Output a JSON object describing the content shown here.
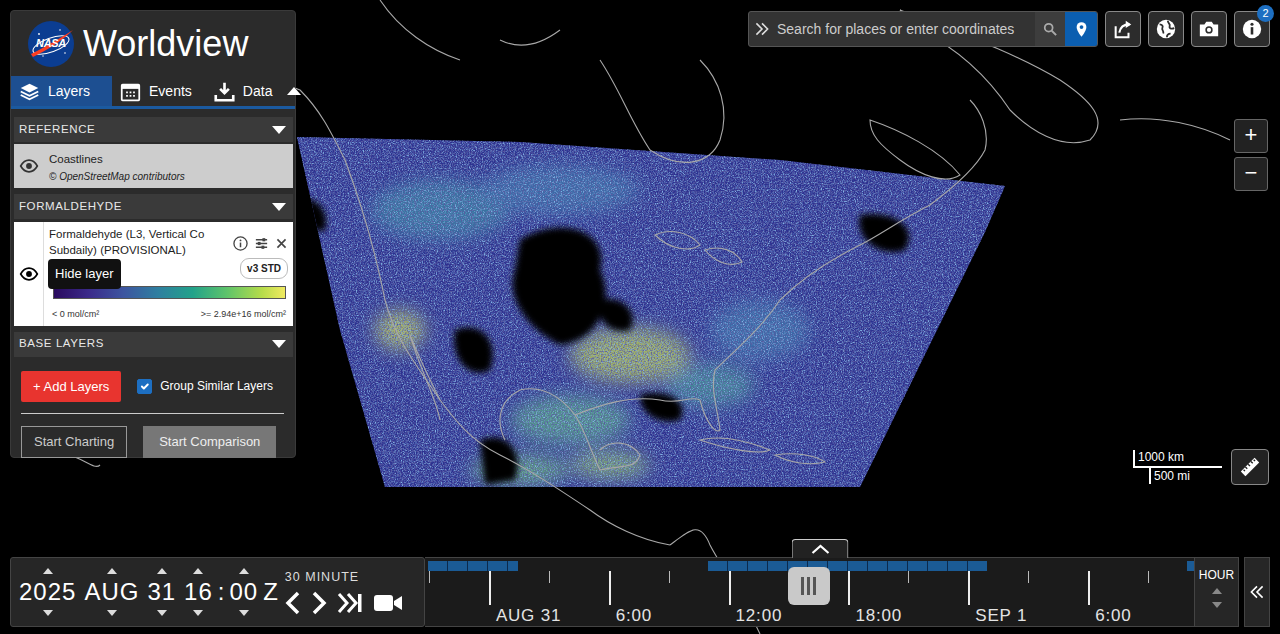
{
  "app": {
    "logo_text": "NASA",
    "title": "Worldview"
  },
  "tabs": [
    {
      "label": "Layers",
      "selected": true
    },
    {
      "label": "Events",
      "selected": false
    },
    {
      "label": "Data",
      "selected": false
    }
  ],
  "layer_groups": [
    {
      "title": "REFERENCE",
      "expanded": true,
      "layers": [
        {
          "kind": "reference",
          "title_lines": [
            "Coastlines"
          ],
          "subtitle": "© OpenStreetMap contributors",
          "visible": true
        }
      ]
    },
    {
      "title": "FORMALDEHYDE",
      "expanded": true,
      "layers": [
        {
          "kind": "data",
          "title_lines": [
            "Formaldehyde (L3, Vertical Co",
            "Subdaily) (PROVISIONAL)"
          ],
          "badge": "v3 STD",
          "visible": true,
          "tooltip": "Hide layer",
          "legend": {
            "min": "< 0 mol/cm²",
            "max": ">= 2.94e+16 mol/cm²"
          }
        }
      ]
    },
    {
      "title": "BASE LAYERS",
      "expanded": true,
      "layers": []
    }
  ],
  "actions": {
    "add_layers": "+ Add Layers",
    "group_similar": {
      "label": "Group Similar Layers",
      "checked": true
    },
    "buttons": [
      {
        "label": "Start Charting",
        "kind": "outline"
      },
      {
        "label": "Start Comparison",
        "kind": "filled"
      }
    ]
  },
  "search": {
    "placeholder": "Search for places or enter coordinates"
  },
  "toolbar": {
    "info_badge": "2"
  },
  "zoom": {
    "in": "+",
    "out": "−"
  },
  "scale": {
    "metric": "1000 km",
    "imperial": "500 mi"
  },
  "timeline": {
    "date_parts": [
      {
        "kind": "field",
        "text": "2025"
      },
      {
        "kind": "field",
        "text": "AUG"
      },
      {
        "kind": "field",
        "text": "31"
      },
      {
        "kind": "field",
        "text": "16"
      },
      {
        "kind": "separator",
        "text": ":"
      },
      {
        "kind": "field",
        "text": "00"
      },
      {
        "kind": "separator",
        "text": "Z"
      }
    ],
    "interval": "30 MINUTE",
    "timescale": "HOUR",
    "axis": {
      "start": -3.2,
      "end": 35.3
    },
    "ticks": [
      {
        "label": "AUG 31",
        "hour": 0
      },
      {
        "label": "6:00",
        "hour": 6
      },
      {
        "label": "12:00",
        "hour": 12
      },
      {
        "label": "18:00",
        "hour": 18
      },
      {
        "label": "SEP 1",
        "hour": 24
      },
      {
        "label": "6:00",
        "hour": 30
      }
    ],
    "availability": [
      {
        "start": -3.05,
        "end": 1.45
      },
      {
        "start": 10.95,
        "end": 24.95
      },
      {
        "start": 34.95,
        "end": 35.3
      }
    ],
    "handle": {
      "level": 0.499
    }
  }
}
